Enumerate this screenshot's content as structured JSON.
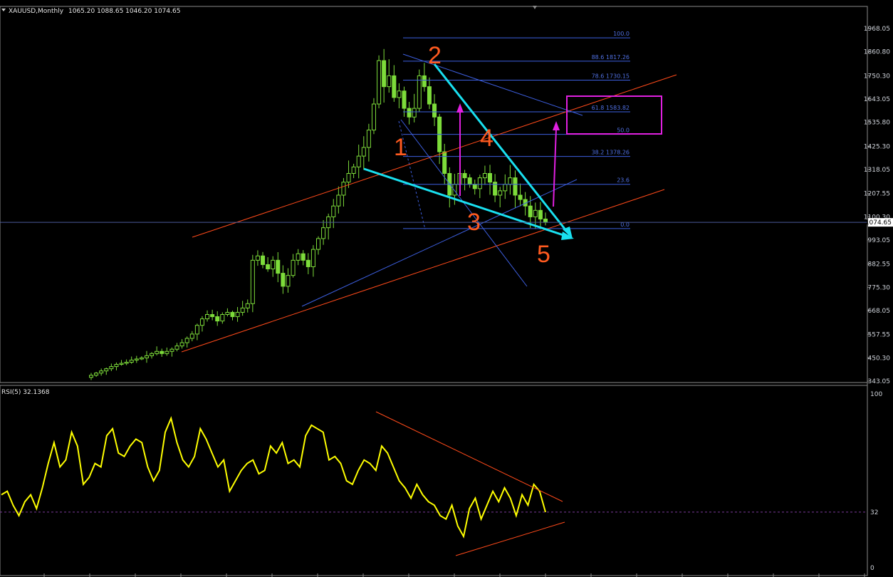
{
  "header": {
    "symbol": "XAUUSD,Monthly",
    "ohlc": "1065.20 1088.65 1046.20 1074.65"
  },
  "rsi_panel": {
    "title": "RSI(5) 32.1368"
  },
  "chart_data": [
    {
      "type": "candlestick",
      "title": "XAUUSD,Monthly",
      "y_ticks": [
        "1968.05",
        "1860.80",
        "1750.30",
        "1643.05",
        "1535.80",
        "1425.30",
        "1318.05",
        "1207.55",
        "1100.30",
        "993.05",
        "882.55",
        "775.30",
        "668.05",
        "557.55",
        "450.30",
        "343.05"
      ],
      "ylim": [
        343.05,
        1968.05
      ],
      "current_price": "1074.65",
      "close_series": [
        370,
        380,
        390,
        400,
        410,
        420,
        425,
        430,
        440,
        445,
        450,
        460,
        470,
        480,
        470,
        480,
        490,
        505,
        520,
        540,
        560,
        600,
        630,
        650,
        640,
        620,
        650,
        660,
        640,
        660,
        680,
        700,
        900,
        920,
        880,
        860,
        900,
        840,
        780,
        830,
        900,
        930,
        900,
        870,
        950,
        1000,
        1050,
        1100,
        1150,
        1200,
        1260,
        1300,
        1330,
        1380,
        1420,
        1500,
        1620,
        1820,
        1700,
        1750,
        1650,
        1680,
        1600,
        1560,
        1600,
        1750,
        1700,
        1620,
        1560,
        1400,
        1300,
        1200,
        1250,
        1300,
        1280,
        1250,
        1230,
        1280,
        1300,
        1260,
        1200,
        1220,
        1250,
        1280,
        1200,
        1180,
        1150,
        1100,
        1130,
        1090,
        1074.65
      ],
      "fib_levels": [
        {
          "label": "100.0",
          "value": 1925
        },
        {
          "label": "88.6  1817.26",
          "value": 1817.26
        },
        {
          "label": "78.6  1730.15",
          "value": 1730.15
        },
        {
          "label": "61.8  1583.82",
          "value": 1583.82
        },
        {
          "label": "50.0",
          "value": 1480
        },
        {
          "label": "38.2  1378.26",
          "value": 1378.26
        },
        {
          "label": "23.6",
          "value": 1250
        },
        {
          "label": "0.0",
          "value": 1046
        }
      ],
      "wave_labels": [
        "1",
        "2",
        "3",
        "4",
        "5"
      ],
      "colors": {
        "bull": "#7ddc3a",
        "bear": "#7ddc3a",
        "fib": "#3d5fe0",
        "channel": "#ff4a1a",
        "trend": "#19e0f0",
        "target": "#e020e0"
      }
    },
    {
      "type": "line",
      "title": "RSI(5) 32.1368",
      "y_ticks": [
        "100",
        "32",
        "0"
      ],
      "ylim": [
        0,
        100
      ],
      "values": [
        42,
        44,
        36,
        30,
        38,
        42,
        34,
        46,
        60,
        72,
        58,
        62,
        78,
        70,
        48,
        52,
        60,
        58,
        76,
        80,
        66,
        64,
        70,
        74,
        72,
        58,
        50,
        56,
        78,
        86,
        72,
        62,
        58,
        64,
        80,
        74,
        66,
        58,
        62,
        44,
        50,
        56,
        60,
        62,
        54,
        56,
        70,
        66,
        72,
        60,
        62,
        58,
        76,
        82,
        80,
        78,
        62,
        64,
        60,
        50,
        48,
        56,
        62,
        60,
        56,
        70,
        66,
        58,
        50,
        46,
        40,
        48,
        42,
        38,
        36,
        30,
        28,
        36,
        24,
        18,
        34,
        40,
        28,
        36,
        44,
        38,
        46,
        40,
        30,
        42,
        36,
        48,
        44,
        32
      ]
    }
  ]
}
